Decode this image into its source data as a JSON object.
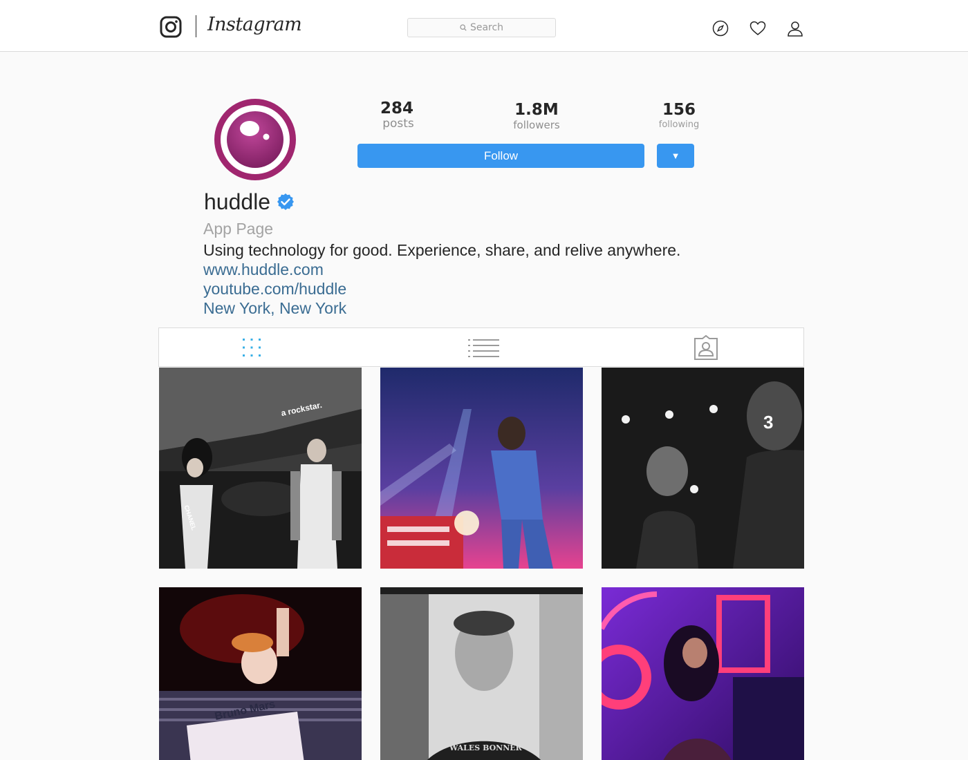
{
  "header": {
    "wordmark": "Instagram",
    "search_placeholder": "Search",
    "icons": [
      "instagram-glyph-icon",
      "compass-icon",
      "heart-icon",
      "person-icon",
      "search-icon"
    ]
  },
  "profile": {
    "username": "huddle",
    "verified": true,
    "category": "App Page",
    "bio": "Using technology for good. Experience, share, and relive anywhere.",
    "links": [
      "www.huddle.com",
      "youtube.com/huddle",
      "New York, New York"
    ],
    "stats": {
      "posts": {
        "value": "284",
        "label": "posts"
      },
      "followers": {
        "value": "1.8M",
        "label": "followers"
      },
      "following": {
        "value": "156",
        "label": "following"
      }
    },
    "follow_label": "Follow",
    "menu_label": "▼",
    "avatar_icon": "huddle-logo-icon",
    "avatar_color": "#a0266f"
  },
  "tabs": [
    {
      "name": "grid",
      "icon": "grid-icon",
      "active": true
    },
    {
      "name": "list",
      "icon": "list-icon",
      "active": false
    },
    {
      "name": "tagged",
      "icon": "tagged-icon",
      "active": false
    }
  ],
  "posts": {
    "overlay_texts": [
      "a rockstar.",
      "CHANEL",
      "3",
      "Bruno Mars",
      "WALES BONNER"
    ]
  },
  "colors": {
    "accent": "#3897f0",
    "link": "#3a6c92",
    "active_tab": "#3ab0e6",
    "avatar": "#a0266f"
  }
}
